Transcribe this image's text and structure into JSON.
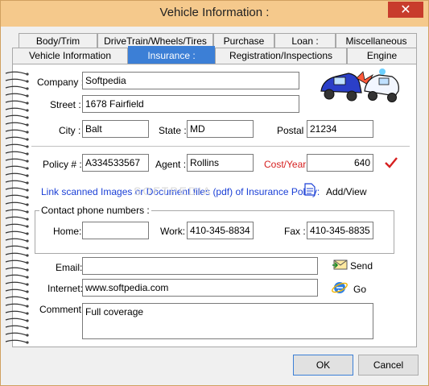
{
  "window": {
    "title": "Vehicle Information :",
    "close_glyph": "✕"
  },
  "tabs_top": [
    {
      "label": "Body/Trim"
    },
    {
      "label": "DriveTrain/Wheels/Tires"
    },
    {
      "label": "Purchase"
    },
    {
      "label": "Loan :"
    },
    {
      "label": "Miscellaneous"
    }
  ],
  "tabs_bottom": [
    {
      "label": "Vehicle Information"
    },
    {
      "label": "Insurance :",
      "active": true
    },
    {
      "label": "Registration/Inspections"
    },
    {
      "label": "Engine"
    }
  ],
  "form": {
    "company_label": "Company :",
    "company_value": "Softpedia",
    "street_label": "Street :",
    "street_value": "1678 Fairfield",
    "city_label": "City :",
    "city_value": "Balt",
    "state_label": "State :",
    "state_value": "MD",
    "postal_label": "Postal :",
    "postal_value": "21234",
    "policy_label": "Policy # :",
    "policy_value": "A334533567",
    "agent_label": "Agent :",
    "agent_value": "Rollins",
    "cost_label": "Cost/Year",
    "cost_value": "640",
    "link_text": "Link scanned Images or Document files (pdf) of Insurance Policy:",
    "add_view_label": "Add/View",
    "contact_group_title": "Contact phone numbers :",
    "home_label": "Home:",
    "home_value": "",
    "work_label": "Work:",
    "work_value": "410-345-8834",
    "fax_label": "Fax :",
    "fax_value": "410-345-8835",
    "email_label": "Email:",
    "email_value": "",
    "send_label": "Send",
    "internet_label": "Internet:",
    "internet_value": "www.softpedia.com",
    "go_label": "Go",
    "comment_label": "Comment:",
    "comment_value": "Full coverage",
    "watermark": "SOFTPEDIA"
  },
  "buttons": {
    "ok": "OK",
    "cancel": "Cancel"
  },
  "colors": {
    "titlebar": "#f5c98c",
    "active_tab": "#3c7fd6",
    "link": "#1a3fd6",
    "cost_label": "#d62020",
    "check": "#d62020"
  },
  "icons": [
    "close-icon",
    "crash-cars-icon",
    "checkmark-icon",
    "document-icon",
    "send-mail-icon",
    "ie-globe-icon",
    "spiral-binding-icon"
  ]
}
